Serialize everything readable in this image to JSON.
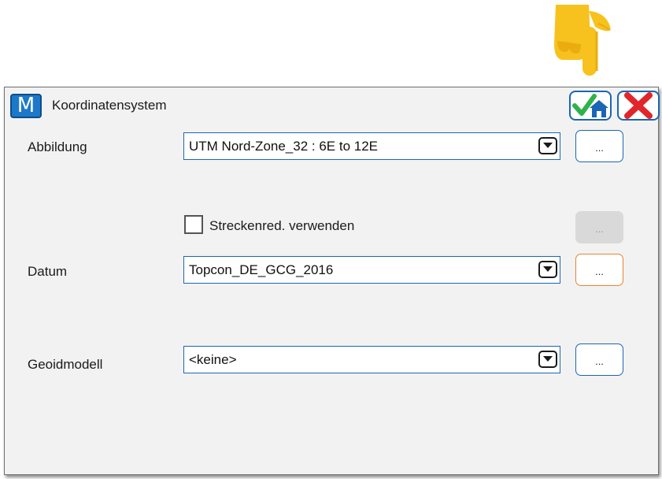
{
  "window": {
    "title": "Koordinatensystem",
    "logo_letter": "M"
  },
  "titlebar": {
    "ok_icon": "check-home-icon",
    "cancel_icon": "red-x-icon"
  },
  "fields": {
    "abbildung": {
      "label": "Abbildung",
      "value": "UTM Nord-Zone_32 : 6E to 12E",
      "more_label": "..."
    },
    "streckenred": {
      "label": "Streckenred. verwenden",
      "checked": false,
      "more_label": "..."
    },
    "datum": {
      "label": "Datum",
      "value": "Topcon_DE_GCG_2016",
      "more_label": "..."
    },
    "geoidmodell": {
      "label": "Geoidmodell",
      "value": "<keine>",
      "more_label": "..."
    }
  },
  "colors": {
    "accent_blue": "#1b65b5",
    "focus_orange": "#e8832f",
    "check_green": "#2db34a",
    "cancel_red": "#e0262a",
    "pointer_yellow": "#f7c11e"
  }
}
